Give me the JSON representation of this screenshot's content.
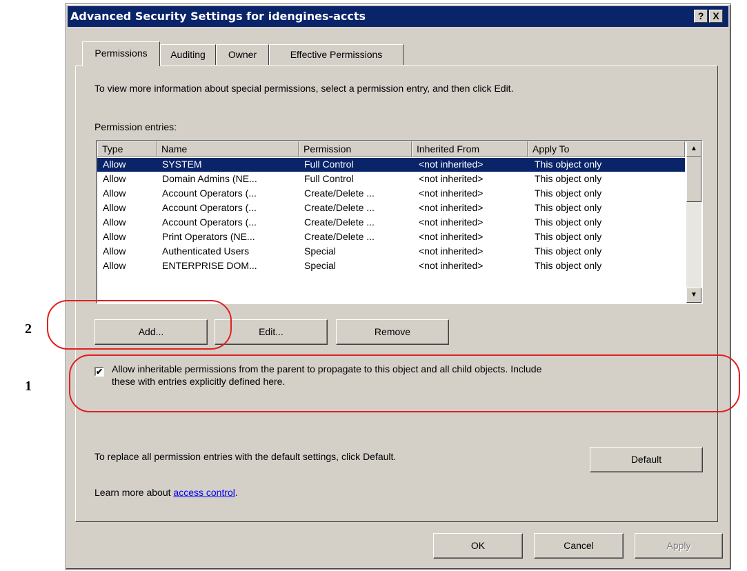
{
  "window": {
    "title": "Advanced Security Settings for idengines-accts",
    "help_btn": "?",
    "close_btn": "X"
  },
  "tabs": [
    {
      "label": "Permissions"
    },
    {
      "label": "Auditing"
    },
    {
      "label": "Owner"
    },
    {
      "label": "Effective Permissions"
    }
  ],
  "panel": {
    "info_text": "To view more information about special permissions, select a permission entry, and then click Edit.",
    "entries_label": "Permission entries:",
    "columns": [
      "Type",
      "Name",
      "Permission",
      "Inherited From",
      "Apply To"
    ],
    "rows": [
      [
        "Allow",
        "SYSTEM",
        "Full Control",
        "<not inherited>",
        "This object only"
      ],
      [
        "Allow",
        "Domain Admins (NE...",
        "Full Control",
        "<not inherited>",
        "This object only"
      ],
      [
        "Allow",
        "Account Operators (...",
        "Create/Delete ...",
        "<not inherited>",
        "This object only"
      ],
      [
        "Allow",
        "Account Operators (...",
        "Create/Delete ...",
        "<not inherited>",
        "This object only"
      ],
      [
        "Allow",
        "Account Operators (...",
        "Create/Delete ...",
        "<not inherited>",
        "This object only"
      ],
      [
        "Allow",
        "Print Operators (NE...",
        "Create/Delete ...",
        "<not inherited>",
        "This object only"
      ],
      [
        "Allow",
        "Authenticated Users",
        "Special",
        "<not inherited>",
        "This object only"
      ],
      [
        "Allow",
        "ENTERPRISE DOM...",
        "Special",
        "<not inherited>",
        "This object only"
      ]
    ],
    "add_btn": "Add...",
    "edit_btn": "Edit...",
    "remove_btn": "Remove",
    "inherit_line1": "Allow inheritable permissions from the parent to propagate to this object and all child objects. Include",
    "inherit_line2": "these with entries explicitly defined here.",
    "inherit_checked": true,
    "check_mark": "✔",
    "default_text": "To replace all permission entries with the default settings, click Default.",
    "default_btn": "Default",
    "learn_prefix": "Learn more about ",
    "learn_link": "access control",
    "learn_suffix": "."
  },
  "footer": {
    "ok_btn": "OK",
    "cancel_btn": "Cancel",
    "apply_btn": "Apply"
  },
  "annotations": {
    "callout_add": "2",
    "callout_inherit": "1",
    "color": "#e02020"
  },
  "colors": {
    "titlebar": "#0a246a",
    "face": "#d4d0c8",
    "selection": "#0a246a"
  }
}
